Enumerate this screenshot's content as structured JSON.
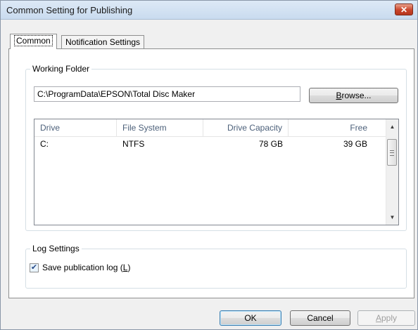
{
  "window": {
    "title": "Common Setting for Publishing",
    "close_glyph": "✕"
  },
  "tabs": [
    {
      "label": "Common",
      "active": true
    },
    {
      "label": "Notification Settings",
      "active": false
    }
  ],
  "working_folder": {
    "title": "Working Folder",
    "path": "C:\\ProgramData\\EPSON\\Total Disc Maker",
    "browse_label_pre": "",
    "browse_label_key": "B",
    "browse_label_post": "rowse..."
  },
  "drives": {
    "columns": [
      "Drive",
      "File System",
      "Drive Capacity",
      "Free"
    ],
    "rows": [
      {
        "drive": "C:",
        "file_system": "NTFS",
        "capacity": "78 GB",
        "free": "39 GB"
      }
    ]
  },
  "log_settings": {
    "title": "Log Settings",
    "save_log_checked": true,
    "save_log_label_pre": "Save publication log (",
    "save_log_label_key": "L",
    "save_log_label_post": ")"
  },
  "buttons": {
    "ok": "OK",
    "cancel": "Cancel",
    "apply_key": "A",
    "apply_rest": "pply",
    "apply_enabled": false
  },
  "icons": {
    "scroll_up": "scroll-up-arrow-icon",
    "scroll_down": "scroll-down-arrow-icon",
    "checkmark": "checkmark-icon",
    "close": "close-icon"
  }
}
